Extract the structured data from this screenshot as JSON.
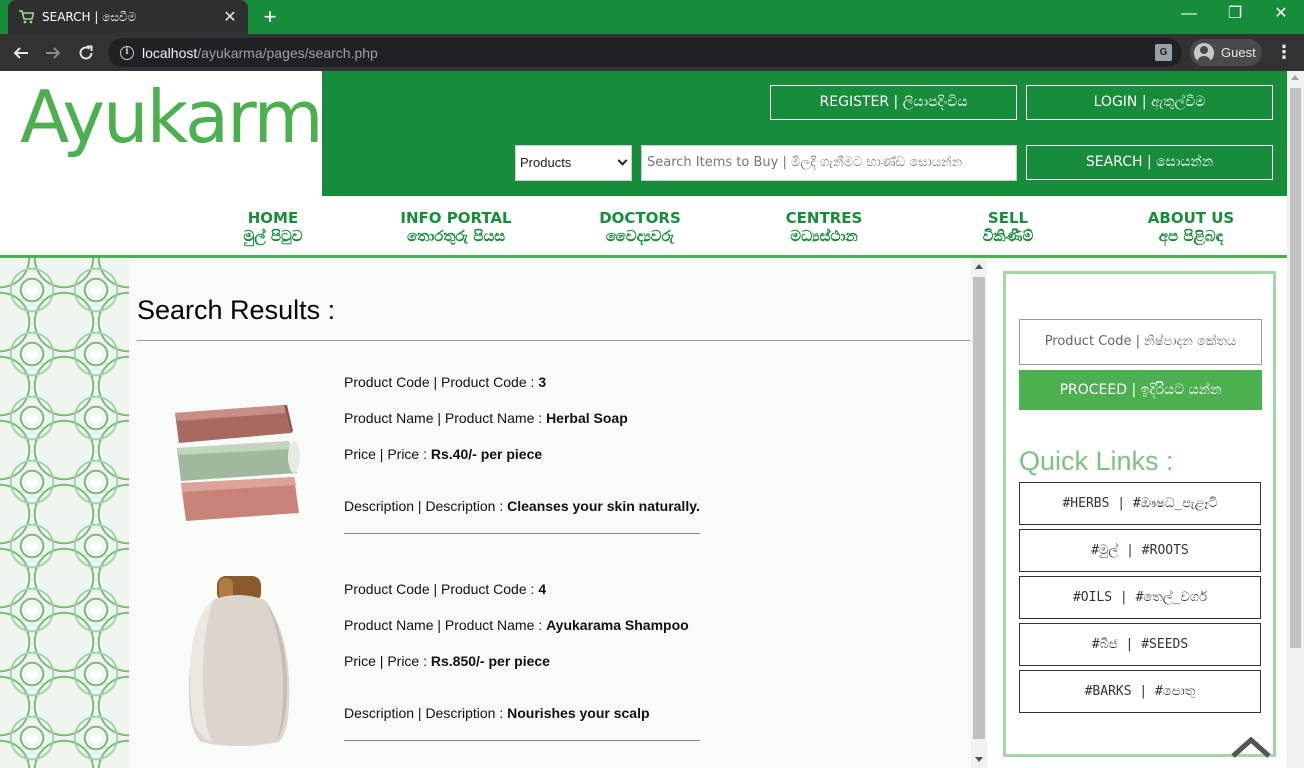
{
  "browser": {
    "tab_title": "SEARCH | සෙවීම",
    "tab_close": "✕",
    "new_tab": "+",
    "url_host": "localhost",
    "url_path": "/ayukarma/pages/search.php",
    "profile_label": "Guest",
    "window_controls": {
      "minimize": "—",
      "maximize": "❐",
      "close": "✕"
    }
  },
  "header": {
    "logo_text": "Ayukarma",
    "register_label": "REGISTER  |  ලියාපදිංචිය",
    "login_label": "LOGIN  |  ඇතුල්වීම",
    "category_selected": "Products",
    "search_placeholder": "Search Items to Buy | මිලදී ගැනීමට භාණ්ඩ සොයන්න",
    "search_label": "SEARCH  |  සොයන්න"
  },
  "nav": [
    {
      "en": "HOME",
      "si": "මුල් පිටුව"
    },
    {
      "en": "INFO PORTAL",
      "si": "තොරතුරු පියස"
    },
    {
      "en": "DOCTORS",
      "si": "වෛද්‍යවරු"
    },
    {
      "en": "CENTRES",
      "si": "මධ්‍යස්ථාන"
    },
    {
      "en": "SELL",
      "si": "විකිණීම්"
    },
    {
      "en": "ABOUT US",
      "si": "අප පිළිබඳ"
    }
  ],
  "results": {
    "title": "Search Results :",
    "products": [
      {
        "code_label": "Product Code | Product Code : ",
        "code": "3",
        "name_label": "Product Name | Product Name : ",
        "name": "Herbal Soap",
        "price_label": "Price | Price : ",
        "price": "Rs.40/- per piece",
        "desc_label": "Description | Description : ",
        "desc": "Cleanses your skin naturally."
      },
      {
        "code_label": "Product Code | Product Code : ",
        "code": "4",
        "name_label": "Product Name | Product Name : ",
        "name": "Ayukarama Shampoo",
        "price_label": "Price | Price : ",
        "price": "Rs.850/- per piece",
        "desc_label": "Description | Description : ",
        "desc": "Nourishes your scalp"
      }
    ]
  },
  "sidebar": {
    "code_placeholder": "Product Code | නිෂ්පාදන කේතය",
    "proceed_label": "PROCEED | ඉදිරියට යන්න",
    "quick_links_title": "Quick Links :",
    "quick_links": [
      "#HERBS   |   #ඖෂධ_පැළෑටි",
      "#මුල්   |   #ROOTS",
      "#OILS   |   #තෙල්_වර්ග",
      "#බීජ   |   #SEEDS",
      "#BARKS   |   #පොතු"
    ]
  },
  "colors": {
    "brand_green": "#178c3a",
    "accent_green": "#4caf50",
    "light_green": "#a5d6a7"
  }
}
